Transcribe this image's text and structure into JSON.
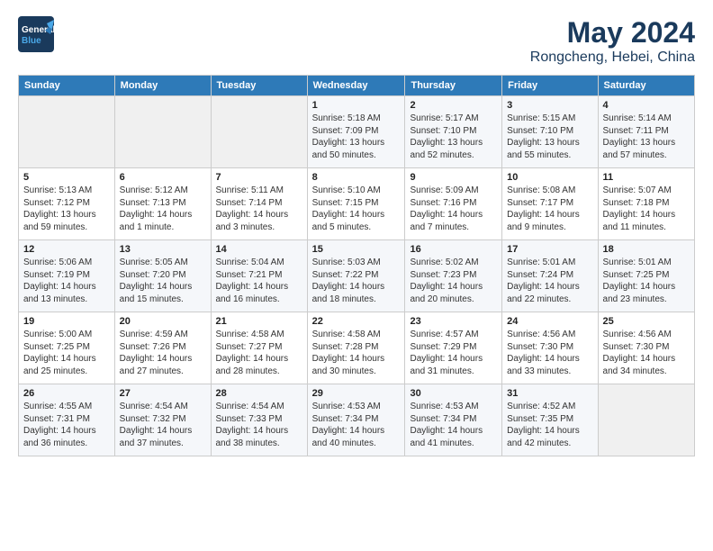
{
  "header": {
    "logo_line1": "General",
    "logo_line2": "Blue",
    "title": "May 2024",
    "subtitle": "Rongcheng, Hebei, China"
  },
  "calendar": {
    "columns": [
      "Sunday",
      "Monday",
      "Tuesday",
      "Wednesday",
      "Thursday",
      "Friday",
      "Saturday"
    ],
    "weeks": [
      [
        {
          "day": "",
          "info": ""
        },
        {
          "day": "",
          "info": ""
        },
        {
          "day": "",
          "info": ""
        },
        {
          "day": "1",
          "info": "Sunrise: 5:18 AM\nSunset: 7:09 PM\nDaylight: 13 hours\nand 50 minutes."
        },
        {
          "day": "2",
          "info": "Sunrise: 5:17 AM\nSunset: 7:10 PM\nDaylight: 13 hours\nand 52 minutes."
        },
        {
          "day": "3",
          "info": "Sunrise: 5:15 AM\nSunset: 7:10 PM\nDaylight: 13 hours\nand 55 minutes."
        },
        {
          "day": "4",
          "info": "Sunrise: 5:14 AM\nSunset: 7:11 PM\nDaylight: 13 hours\nand 57 minutes."
        }
      ],
      [
        {
          "day": "5",
          "info": "Sunrise: 5:13 AM\nSunset: 7:12 PM\nDaylight: 13 hours\nand 59 minutes."
        },
        {
          "day": "6",
          "info": "Sunrise: 5:12 AM\nSunset: 7:13 PM\nDaylight: 14 hours\nand 1 minute."
        },
        {
          "day": "7",
          "info": "Sunrise: 5:11 AM\nSunset: 7:14 PM\nDaylight: 14 hours\nand 3 minutes."
        },
        {
          "day": "8",
          "info": "Sunrise: 5:10 AM\nSunset: 7:15 PM\nDaylight: 14 hours\nand 5 minutes."
        },
        {
          "day": "9",
          "info": "Sunrise: 5:09 AM\nSunset: 7:16 PM\nDaylight: 14 hours\nand 7 minutes."
        },
        {
          "day": "10",
          "info": "Sunrise: 5:08 AM\nSunset: 7:17 PM\nDaylight: 14 hours\nand 9 minutes."
        },
        {
          "day": "11",
          "info": "Sunrise: 5:07 AM\nSunset: 7:18 PM\nDaylight: 14 hours\nand 11 minutes."
        }
      ],
      [
        {
          "day": "12",
          "info": "Sunrise: 5:06 AM\nSunset: 7:19 PM\nDaylight: 14 hours\nand 13 minutes."
        },
        {
          "day": "13",
          "info": "Sunrise: 5:05 AM\nSunset: 7:20 PM\nDaylight: 14 hours\nand 15 minutes."
        },
        {
          "day": "14",
          "info": "Sunrise: 5:04 AM\nSunset: 7:21 PM\nDaylight: 14 hours\nand 16 minutes."
        },
        {
          "day": "15",
          "info": "Sunrise: 5:03 AM\nSunset: 7:22 PM\nDaylight: 14 hours\nand 18 minutes."
        },
        {
          "day": "16",
          "info": "Sunrise: 5:02 AM\nSunset: 7:23 PM\nDaylight: 14 hours\nand 20 minutes."
        },
        {
          "day": "17",
          "info": "Sunrise: 5:01 AM\nSunset: 7:24 PM\nDaylight: 14 hours\nand 22 minutes."
        },
        {
          "day": "18",
          "info": "Sunrise: 5:01 AM\nSunset: 7:25 PM\nDaylight: 14 hours\nand 23 minutes."
        }
      ],
      [
        {
          "day": "19",
          "info": "Sunrise: 5:00 AM\nSunset: 7:25 PM\nDaylight: 14 hours\nand 25 minutes."
        },
        {
          "day": "20",
          "info": "Sunrise: 4:59 AM\nSunset: 7:26 PM\nDaylight: 14 hours\nand 27 minutes."
        },
        {
          "day": "21",
          "info": "Sunrise: 4:58 AM\nSunset: 7:27 PM\nDaylight: 14 hours\nand 28 minutes."
        },
        {
          "day": "22",
          "info": "Sunrise: 4:58 AM\nSunset: 7:28 PM\nDaylight: 14 hours\nand 30 minutes."
        },
        {
          "day": "23",
          "info": "Sunrise: 4:57 AM\nSunset: 7:29 PM\nDaylight: 14 hours\nand 31 minutes."
        },
        {
          "day": "24",
          "info": "Sunrise: 4:56 AM\nSunset: 7:30 PM\nDaylight: 14 hours\nand 33 minutes."
        },
        {
          "day": "25",
          "info": "Sunrise: 4:56 AM\nSunset: 7:30 PM\nDaylight: 14 hours\nand 34 minutes."
        }
      ],
      [
        {
          "day": "26",
          "info": "Sunrise: 4:55 AM\nSunset: 7:31 PM\nDaylight: 14 hours\nand 36 minutes."
        },
        {
          "day": "27",
          "info": "Sunrise: 4:54 AM\nSunset: 7:32 PM\nDaylight: 14 hours\nand 37 minutes."
        },
        {
          "day": "28",
          "info": "Sunrise: 4:54 AM\nSunset: 7:33 PM\nDaylight: 14 hours\nand 38 minutes."
        },
        {
          "day": "29",
          "info": "Sunrise: 4:53 AM\nSunset: 7:34 PM\nDaylight: 14 hours\nand 40 minutes."
        },
        {
          "day": "30",
          "info": "Sunrise: 4:53 AM\nSunset: 7:34 PM\nDaylight: 14 hours\nand 41 minutes."
        },
        {
          "day": "31",
          "info": "Sunrise: 4:52 AM\nSunset: 7:35 PM\nDaylight: 14 hours\nand 42 minutes."
        },
        {
          "day": "",
          "info": ""
        }
      ]
    ]
  }
}
